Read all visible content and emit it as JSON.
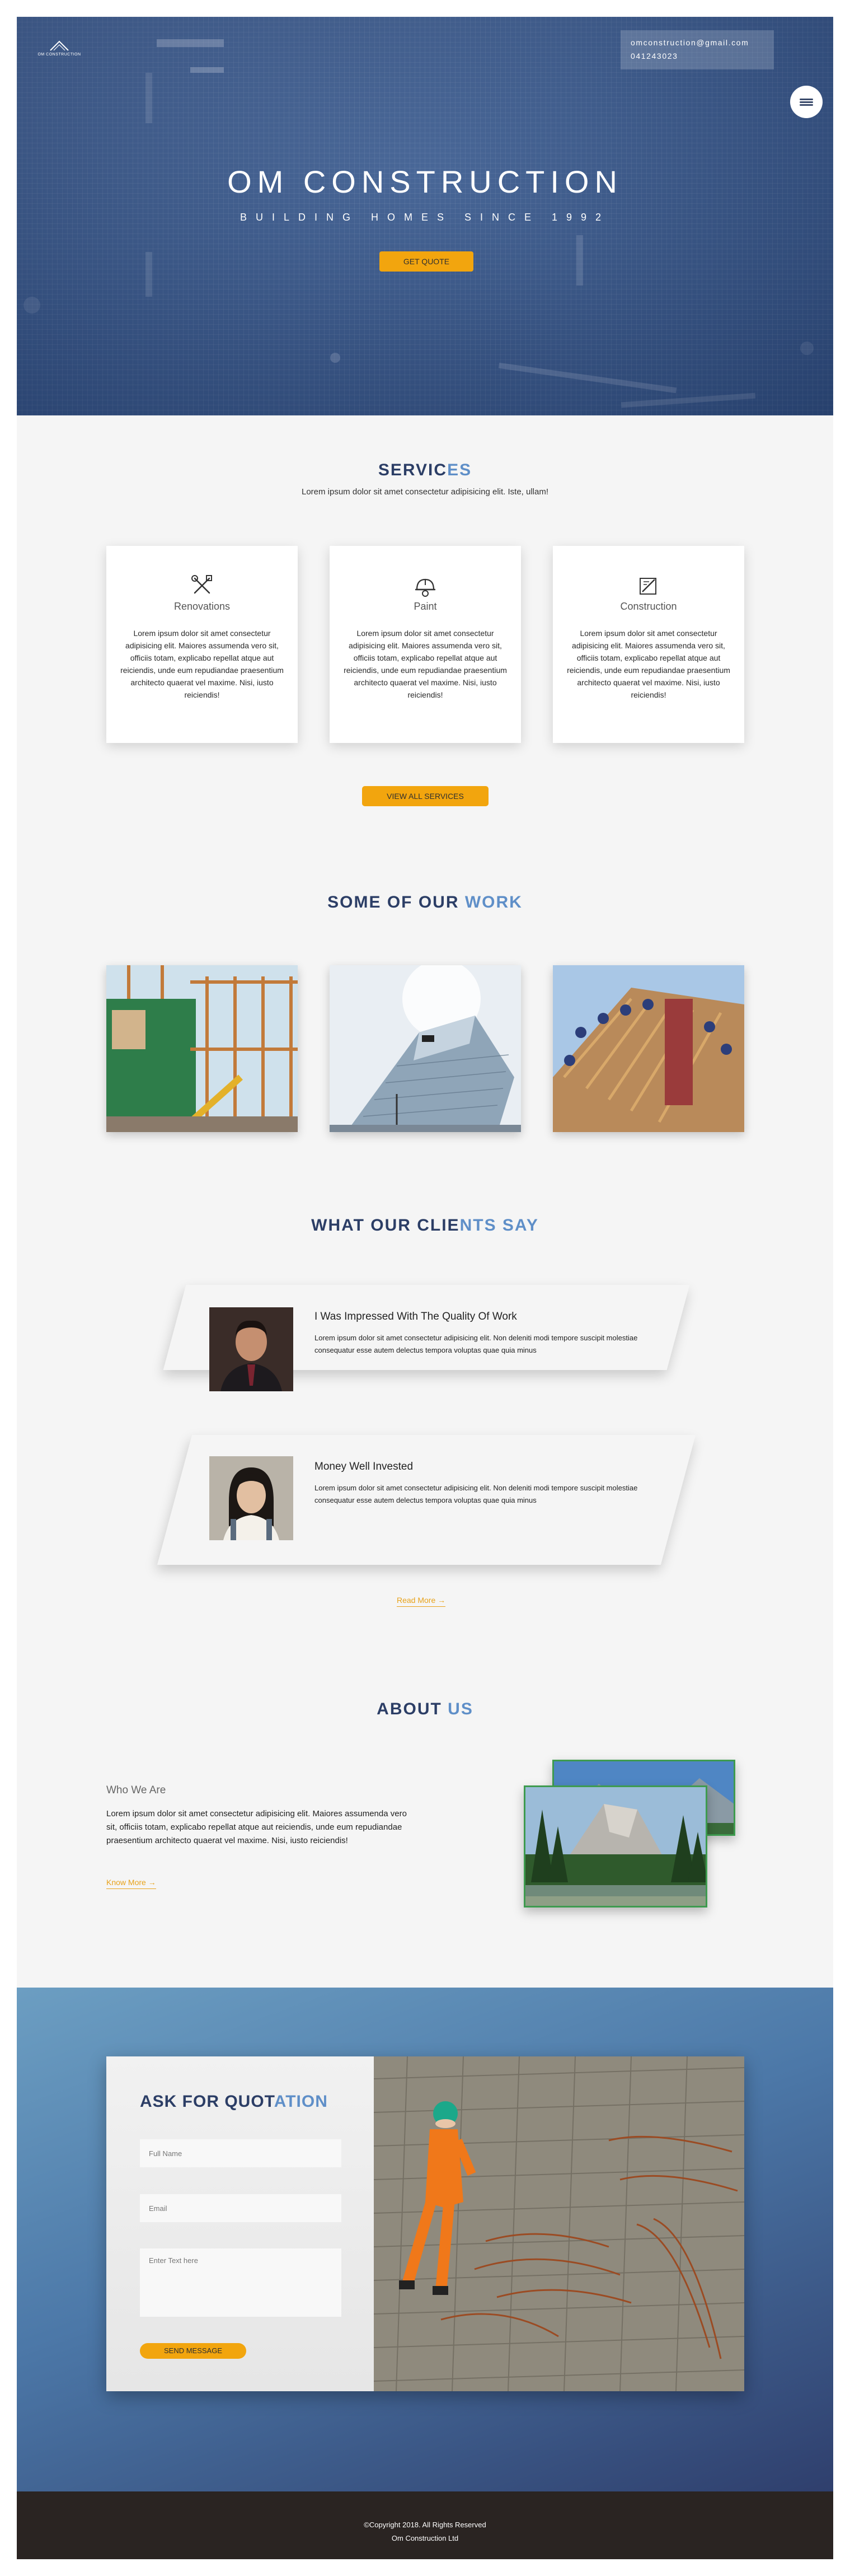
{
  "hero": {
    "logo_text": "OM CONSTRUCTION",
    "contact_email": "omconstruction@gmail.com",
    "contact_phone": "041243023",
    "title": "OM CONSTRUCTION",
    "subtitle": "BUILDING HOMES SINCE 1992",
    "cta_label": "GET QUOTE"
  },
  "services": {
    "title_main": "SERVIC",
    "title_hl": "ES",
    "lead": "Lorem ipsum dolor sit amet consectetur adipisicing elit. Iste, ullam!",
    "cards": [
      {
        "icon": "tools-icon",
        "label": "Renovations",
        "text": "Lorem ipsum dolor sit amet consectetur adipisicing elit. Maiores assumenda vero sit, officiis totam, explicabo repellat atque aut reiciendis, unde eum repudiandae praesentium architecto quaerat vel maxime. Nisi, iusto reiciendis!"
      },
      {
        "icon": "hard-hat-icon",
        "label": "Paint",
        "text": "Lorem ipsum dolor sit amet consectetur adipisicing elit. Maiores assumenda vero sit, officiis totam, explicabo repellat atque aut reiciendis, unde eum repudiandae praesentium architecto quaerat vel maxime. Nisi, iusto reiciendis!"
      },
      {
        "icon": "blueprint-icon",
        "label": "Construction",
        "text": "Lorem ipsum dolor sit amet consectetur adipisicing elit. Maiores assumenda vero sit, officiis totam, explicabo repellat atque aut reiciendis, unde eum repudiandae praesentium architecto quaerat vel maxime. Nisi, iusto reiciendis!"
      }
    ],
    "button_label": "VIEW ALL SERVICES"
  },
  "work": {
    "title_main": "SOME OF OUR ",
    "title_hl": "WORK"
  },
  "testimonials": {
    "title_main": "WHAT OUR CLIE",
    "title_hl": "NTS SAY",
    "items": [
      {
        "title": "I Was Impressed With The Quality Of Work",
        "text": "Lorem ipsum dolor sit amet consectetur adipisicing elit. Non deleniti modi tempore suscipit molestiae consequatur esse autem delectus tempora voluptas quae quia minus"
      },
      {
        "title": "Money Well Invested",
        "text": "Lorem ipsum dolor sit amet consectetur adipisicing elit. Non deleniti modi tempore suscipit molestiae consequatur esse autem delectus tempora voluptas quae quia minus"
      }
    ],
    "read_more": "Read More →"
  },
  "about": {
    "title_main": "ABOUT ",
    "title_hl": "US",
    "heading": "Who We Are",
    "text": "Lorem ipsum dolor sit amet consectetur adipisicing elit. Maiores assumenda vero sit, officiis totam, explicabo repellat atque aut reiciendis, unde eum repudiandae praesentium architecto quaerat vel maxime. Nisi, iusto reiciendis!",
    "link": "Know More →"
  },
  "quote": {
    "title_main": "ASK FOR QUOT",
    "title_hl": "ATION",
    "name_placeholder": "Full Name",
    "email_placeholder": "Email",
    "message_placeholder": "Enter Text here",
    "send_label": "SEND MESSAGE"
  },
  "footer": {
    "copyright": "©Copyright 2018. All Rights Reserved",
    "company": "Om Construction Ltd"
  },
  "colors": {
    "accent": "#f2a50e",
    "heading": "#2c3e66",
    "heading_highlight": "#5f8fc8",
    "hero_blue": "#3f5f92",
    "footer": "#2a2422"
  }
}
